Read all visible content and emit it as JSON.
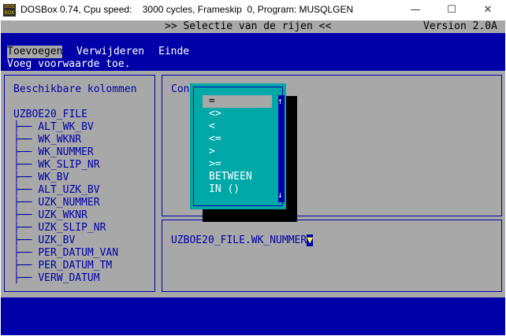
{
  "window": {
    "icon_text": "DOS BOX",
    "title": "DOSBox 0.74, Cpu speed:    3000 cycles, Frameskip  0, Program: MUSQLGEN",
    "minimize": "—",
    "maximize": "☐",
    "close": "✕"
  },
  "header": {
    "title": ">> Selectie van de rijen <<",
    "version": "Version 2.0A"
  },
  "menu": {
    "items": [
      "Toevoegen",
      "Verwijderen",
      "Einde"
    ],
    "hint": "Voeg voorwaarde toe."
  },
  "left_panel": {
    "title": "Beschikbare kolommen",
    "table": "UZBOE20_FILE",
    "branch": "├──",
    "columns": [
      "ALT_WK_BV",
      "WK_WKNR",
      "WK_NUMMER",
      "WK_SLIP_NR",
      "WK_BV",
      "ALT_UZK_BV",
      "UZK_NUMMER",
      "UZK_WKNR",
      "UZK_SLIP_NR",
      "UZK_BV",
      "PER_DATUM_VAN",
      "PER_DATUM_TM",
      "VERW_DATUM"
    ]
  },
  "right_panel": {
    "title_partial": "Con",
    "expression": "UZBOE20_FILE.WK_NUMMER",
    "cursor": "▼"
  },
  "operator_dropdown": {
    "options": [
      "=",
      "<>",
      "<",
      "<=",
      ">",
      ">=",
      "BETWEEN",
      "IN ()"
    ],
    "selected": "=",
    "scroll_up": "↑",
    "scroll_down": "↓"
  },
  "colors": {
    "dos_blue": "#0000a8",
    "dos_gray": "#a8a8a8",
    "dos_cyan": "#00a8a8",
    "dos_white": "#ffffff",
    "cursor_yellow": "#fcfc54"
  }
}
